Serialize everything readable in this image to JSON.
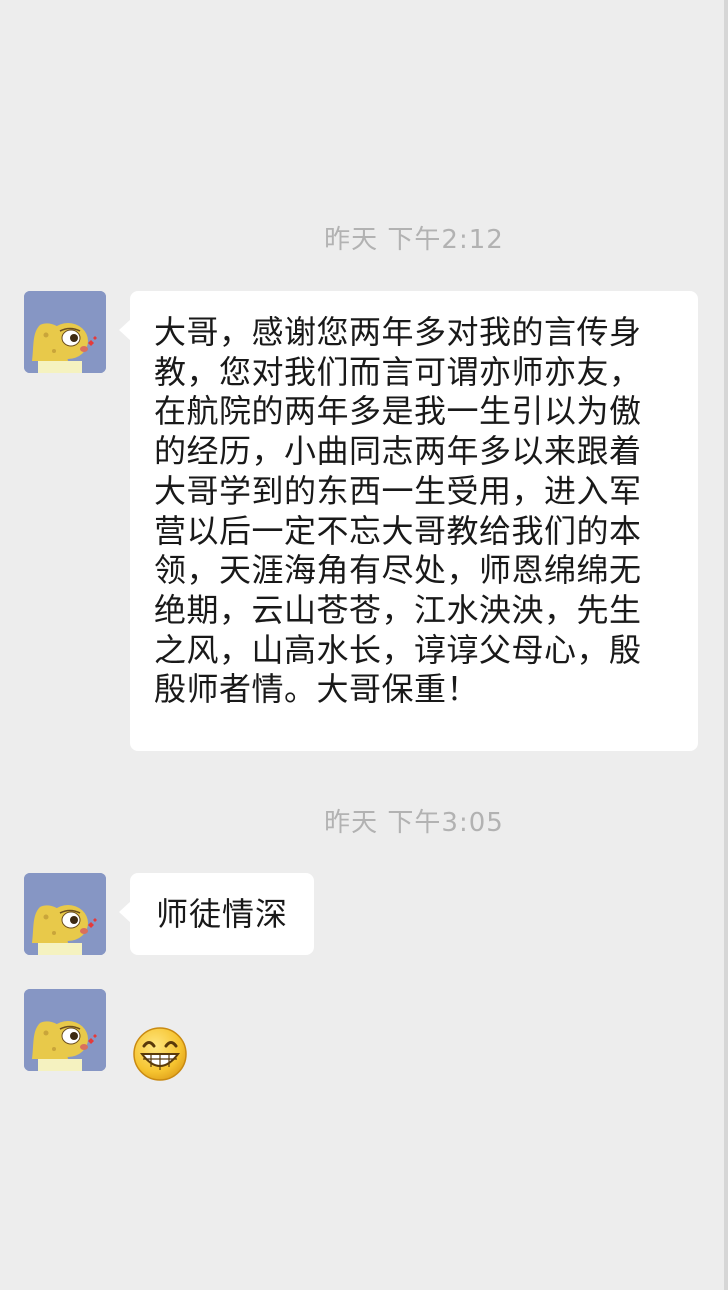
{
  "conversation": {
    "messages": [
      {
        "timestamp": "昨天 下午2:12",
        "lines": [
          "大哥，感谢您两年多对我的言传身",
          "教，您对我们而言可谓亦师亦友，",
          "在航院的两年多是我一生引以为傲",
          "的经历，小曲同志两年多以来跟着",
          "大哥学到的东西一生受用，进入军",
          "营以后一定不忘大哥教给我们的本",
          "领，天涯海角有尽处，师恩绵绵无",
          "绝期，云山苍苍，江水泱泱，先生",
          "之风，山高水长，谆谆父母心，殷",
          "殷师者情。大哥保重！"
        ]
      },
      {
        "timestamp": "昨天 下午3:05",
        "text": "师徒情深"
      },
      {
        "emoji": "grinning-face-emoji"
      }
    ]
  },
  "colors": {
    "background": "#ededed",
    "bubble": "#ffffff",
    "timestamp": "#b2b2b2",
    "text": "#191919"
  },
  "avatar": {
    "icon": "cartoon-sponge-avatar"
  }
}
